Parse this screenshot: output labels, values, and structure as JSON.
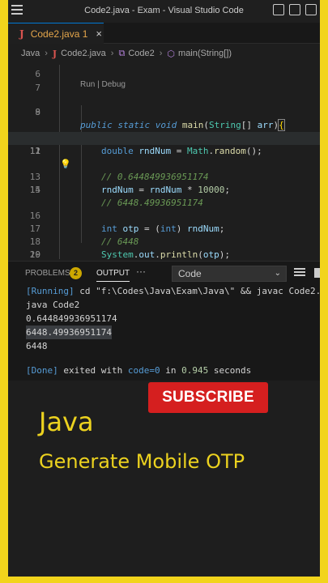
{
  "window": {
    "title": "Code2.java - Exam - Visual Studio Code"
  },
  "tab": {
    "icon": "J",
    "label": "Code2.java 1",
    "close": "×"
  },
  "breadcrumb": {
    "folder": "Java",
    "file": "Code2.java",
    "class": "Code2",
    "method": "main(String[])"
  },
  "editor": {
    "codelens": "Run | Debug",
    "line_numbers": [
      "6",
      "7",
      "8",
      "9",
      "10",
      "11",
      "12",
      "13",
      "14",
      "15",
      "16",
      "17",
      "18",
      "19",
      "20"
    ],
    "main_sig": {
      "kw1": "public",
      "kw2": "static",
      "kw3": "void",
      "fn": "main",
      "p1": "(",
      "type": "String",
      "p2": "[] ",
      "arg": "arr",
      "p3": ")",
      "brace": "{"
    },
    "l10": {
      "type": "double",
      "var": "rndNum",
      "eq": " = ",
      "cls": "Math",
      "dot": ".",
      "fn": "random",
      "tail": "();"
    },
    "l11": "// 0.644849936951174",
    "l13": {
      "var1": "rndNum",
      "eq": " = ",
      "var2": "rndNum",
      "op": " * ",
      "num": "10000",
      "tail": ";"
    },
    "l14": "// 6448.49936951174",
    "l16": {
      "type": "int",
      "var": "otp",
      "eq": " = (",
      "cast": "int",
      "mid": ") ",
      "var2": "rndNum",
      "tail": ";"
    },
    "l17": "// 6448",
    "l18": {
      "cls": "System",
      "dot1": ".",
      "field": "out",
      "dot2": ".",
      "fn": "println",
      "p1": "(",
      "arg": "otp",
      "tail": ");"
    },
    "l19": "}"
  },
  "panel": {
    "tabs": {
      "problems": "PROBLEMS",
      "output": "OUTPUT"
    },
    "problem_count": "2",
    "more": "···",
    "channel": "Code",
    "output": {
      "running_tag": "[Running]",
      "running_cmd": " cd \"f:\\Codes\\Java\\Exam\\Java\\\" && javac Code2.",
      "line2": "java Code2",
      "line3": "0.644849936951174",
      "line4": "6448.49936951174",
      "line5": "6448",
      "done_tag": "[Done]",
      "done_a": " exited with ",
      "done_code": "code=0",
      "done_b": " in ",
      "done_time": "0.945",
      "done_c": " seconds"
    }
  },
  "promo": {
    "subscribe": "SUBSCRIBE",
    "title": "Java",
    "subtitle": "Generate Mobile OTP"
  },
  "colors": {
    "frame": "#f2d41c",
    "promo_text": "#ecd21f",
    "subscribe_bg": "#d51f1f"
  }
}
